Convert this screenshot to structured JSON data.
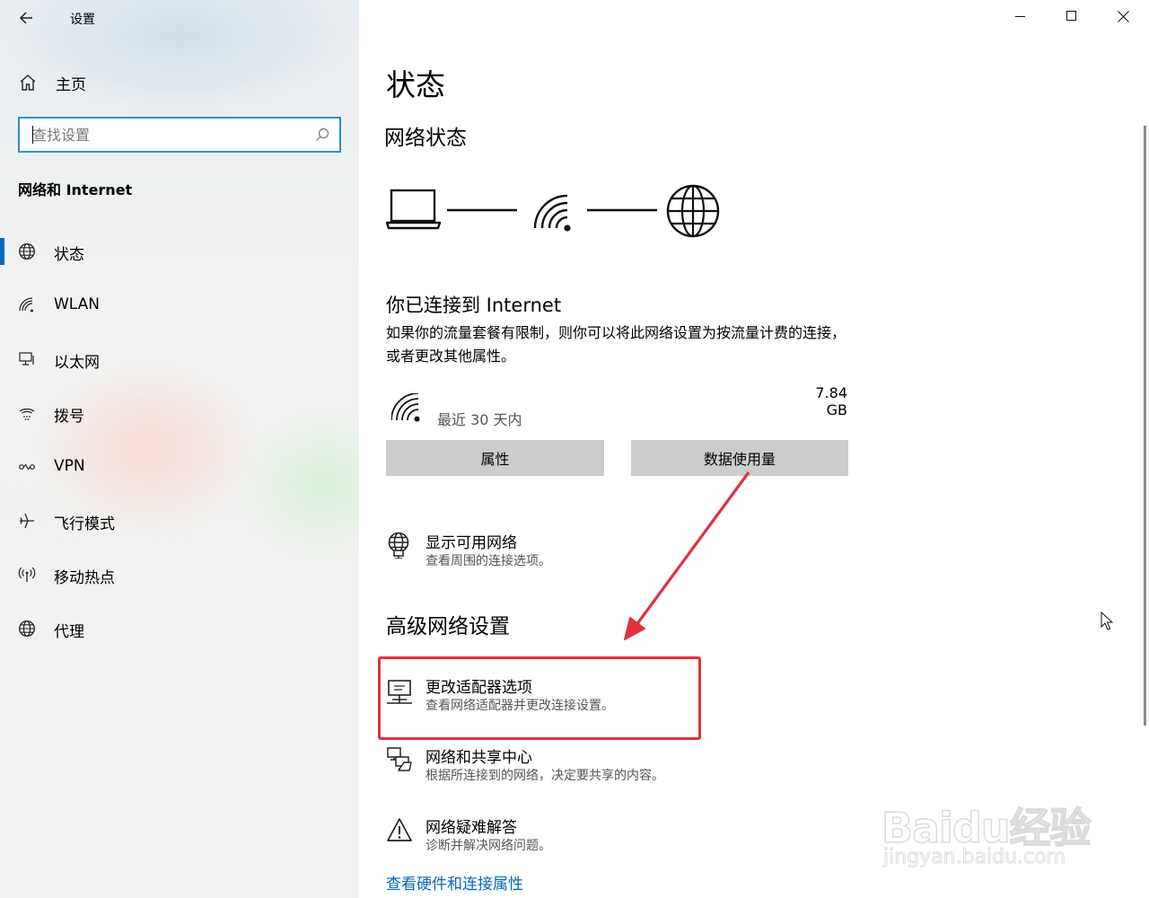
{
  "window": {
    "title": "设置",
    "controls": [
      "minimize-icon",
      "maximize-icon",
      "close-icon"
    ]
  },
  "sidebar": {
    "home_label": "主页",
    "search_placeholder": "查找设置",
    "section_heading": "网络和 Internet",
    "items": [
      {
        "label": "状态",
        "icon": "globe-icon",
        "selected": true
      },
      {
        "label": "WLAN",
        "icon": "wifi-icon",
        "selected": false
      },
      {
        "label": "以太网",
        "icon": "ethernet-icon",
        "selected": false
      },
      {
        "label": "拨号",
        "icon": "dialup-icon",
        "selected": false
      },
      {
        "label": "VPN",
        "icon": "vpn-icon",
        "selected": false
      },
      {
        "label": "飞行模式",
        "icon": "airplane-icon",
        "selected": false
      },
      {
        "label": "移动热点",
        "icon": "hotspot-icon",
        "selected": false
      },
      {
        "label": "代理",
        "icon": "proxy-icon",
        "selected": false
      }
    ]
  },
  "main": {
    "page_title": "状态",
    "network_status_heading": "网络状态",
    "connected_title": "你已连接到 Internet",
    "connected_desc": "如果你的流量套餐有限制，则你可以将此网络设置为按流量计费的连接，或者更改其他属性。",
    "usage": {
      "period": "最近 30 天内",
      "amount": "7.84 GB"
    },
    "buttons": {
      "properties": "属性",
      "data_usage": "数据使用量"
    },
    "show_networks": {
      "title": "显示可用网络",
      "desc": "查看周围的连接选项。"
    },
    "advanced_heading": "高级网络设置",
    "advanced_items": [
      {
        "title": "更改适配器选项",
        "desc": "查看网络适配器并更改连接设置。",
        "icon": "adapter-icon"
      },
      {
        "title": "网络和共享中心",
        "desc": "根据所连接到的网络，决定要共享的内容。",
        "icon": "sharing-center-icon"
      },
      {
        "title": "网络疑难解答",
        "desc": "诊断并解决网络问题。",
        "icon": "warning-icon"
      }
    ],
    "footer_link": "查看硬件和连接属性"
  },
  "watermark": {
    "logo": "Baidu经验",
    "url": "jingyan.baidu.com"
  },
  "colors": {
    "accent": "#0067c0",
    "highlight": "#e0323c",
    "button_bg": "#cccccc",
    "search_border": "#2a8ed0"
  }
}
